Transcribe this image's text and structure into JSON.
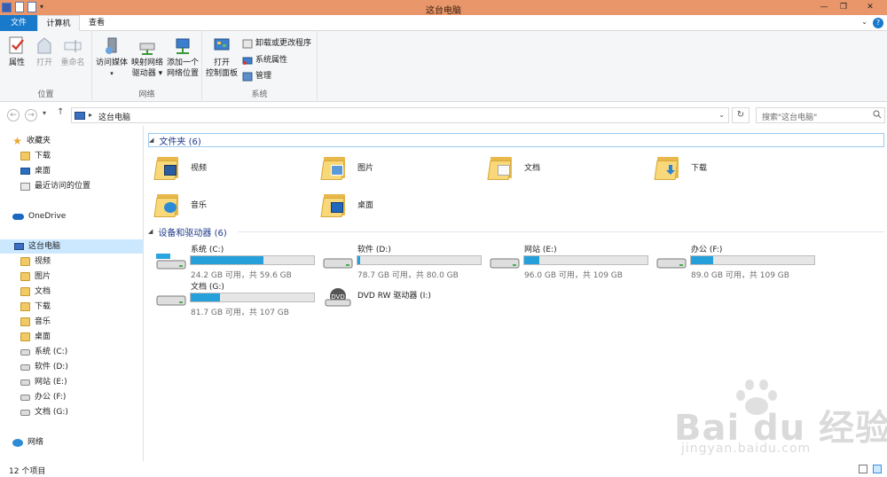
{
  "window": {
    "title": "这台电脑"
  },
  "ribbon": {
    "tabs": [
      "文件",
      "计算机",
      "查看"
    ],
    "groups": {
      "location": {
        "label": "位置",
        "buttons": [
          "属性",
          "打开",
          "重命名"
        ]
      },
      "network": {
        "label": "网络",
        "access_media": "访问媒体",
        "map_drive_1": "映射网络",
        "map_drive_2": "驱动器",
        "add_location_1": "添加一个",
        "add_location_2": "网络位置"
      },
      "system": {
        "label": "系统",
        "open_cp_1": "打开",
        "open_cp_2": "控制面板",
        "uninstall": "卸载或更改程序",
        "sysprops": "系统属性",
        "manage": "管理"
      }
    }
  },
  "address": {
    "crumb": "这台电脑",
    "search_placeholder": "搜索\"这台电脑\""
  },
  "nav": {
    "favorites": "收藏夹",
    "fav_items": [
      "下载",
      "桌面",
      "最近访问的位置"
    ],
    "onedrive": "OneDrive",
    "thispc": "这台电脑",
    "pc_items": [
      "视频",
      "图片",
      "文档",
      "下载",
      "音乐",
      "桌面",
      "系统 (C:)",
      "软件 (D:)",
      "网站 (E:)",
      "办公 (F:)",
      "文档 (G:)"
    ],
    "network": "网络"
  },
  "folders": {
    "header": "文件夹 (6)",
    "items": [
      "视频",
      "图片",
      "文档",
      "下载",
      "音乐",
      "桌面"
    ]
  },
  "drives": {
    "header": "设备和驱动器 (6)",
    "items": [
      {
        "name": "系统 (C:)",
        "free": "24.2 GB 可用，共 59.6 GB",
        "used_fraction": 0.59
      },
      {
        "name": "软件 (D:)",
        "free": "78.7 GB 可用，共 80.0 GB",
        "used_fraction": 0.02
      },
      {
        "name": "网站 (E:)",
        "free": "96.0 GB 可用，共 109 GB",
        "used_fraction": 0.12
      },
      {
        "name": "办公 (F:)",
        "free": "89.0 GB 可用，共 109 GB",
        "used_fraction": 0.18
      },
      {
        "name": "文档 (G:)",
        "free": "81.7 GB 可用，共 107 GB",
        "used_fraction": 0.24
      }
    ],
    "dvd": "DVD RW 驱动器 (I:)"
  },
  "status": {
    "count": "12 个项目"
  },
  "watermark": {
    "brand": "Bai du 经验",
    "url": "jingyan.baidu.com"
  },
  "colors": {
    "titlebar": "#e8966a",
    "file_tab": "#1979ca",
    "bar_fill": "#26a0da",
    "selection": "#cce8ff"
  }
}
